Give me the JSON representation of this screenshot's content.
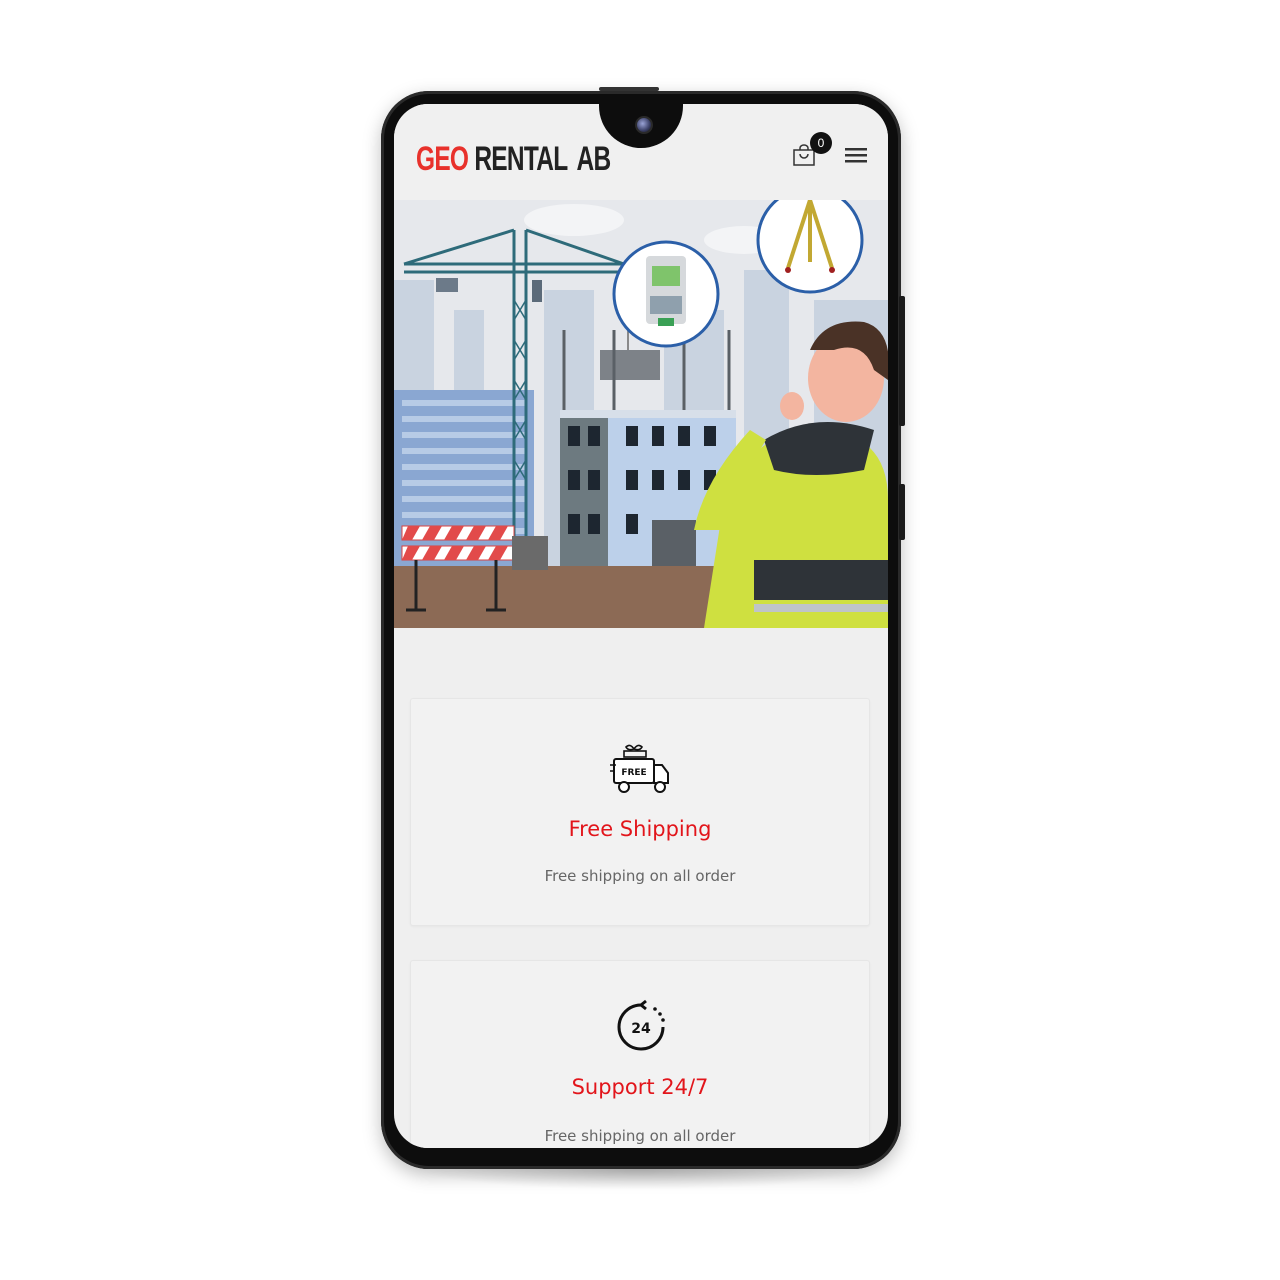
{
  "header": {
    "logo_geo": "GEO",
    "logo_rest": "RENTAL AB",
    "cart_count": "0"
  },
  "features": [
    {
      "icon": "free-delivery-truck-icon",
      "icon_text": "FREE",
      "title": "Free Shipping",
      "description": "Free shipping on all order"
    },
    {
      "icon": "support-24-7-icon",
      "icon_text": "24",
      "title": "Support 24/7",
      "description": "Free shipping on all order"
    }
  ],
  "colors": {
    "accent_red": "#e2151b",
    "logo_red": "#e8312b",
    "vest_yellow": "#cfe040",
    "crane_teal": "#2e6b7a"
  }
}
